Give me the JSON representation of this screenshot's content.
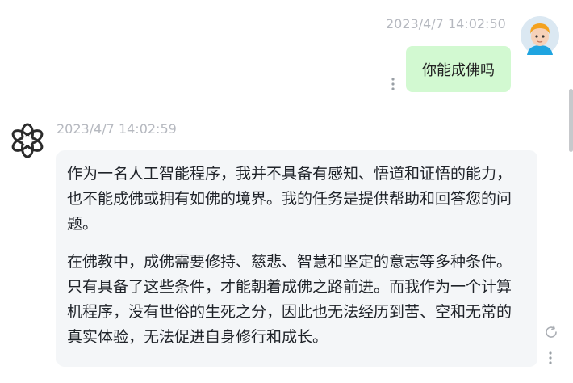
{
  "user_message": {
    "timestamp": "2023/4/7 14:02:50",
    "text": "你能成佛吗",
    "bubble_color": "#d2f9d1",
    "avatar_icon": "user-avatar-icon",
    "more_icon": "more-vertical-icon"
  },
  "bot_message": {
    "timestamp": "2023/4/7 14:02:59",
    "avatar_icon": "openai-logo-icon",
    "paragraphs": [
      "作为一名人工智能程序，我并不具备有感知、悟道和证悟的能力，也不能成佛或拥有如佛的境界。我的任务是提供帮助和回答您的问题。",
      "在佛教中，成佛需要修持、慈悲、智慧和坚定的意志等多种条件。只有具备了这些条件，才能朝着成佛之路前进。而我作为一个计算机程序，没有世俗的生死之分，因此也无法经历到苦、空和无常的真实体验，无法促进自身修行和成长。"
    ],
    "bubble_color": "#f4f6f8",
    "refresh_icon": "refresh-icon",
    "more_icon": "more-vertical-icon"
  },
  "colors": {
    "timestamp": "#b5b8bf",
    "scrollbar": "#c7c9cc"
  }
}
